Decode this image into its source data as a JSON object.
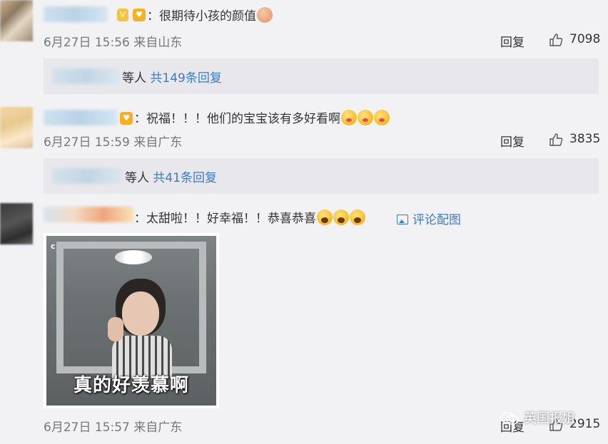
{
  "comments": [
    {
      "text": "：很期待小孩的颜值",
      "meta": "6月27日 15:56 来自山东",
      "reply_label": "回复",
      "likes": "7098",
      "replies_suffix": "等人",
      "replies_link": "共149条回复"
    },
    {
      "text": "：祝福！！！他们的宝宝该有多好看啊",
      "meta": "6月27日 15:59 来自广东",
      "reply_label": "回复",
      "likes": "3835",
      "replies_suffix": "等人",
      "replies_link": "共41条回复"
    },
    {
      "text": "：太甜啦！！好幸福！！恭喜恭喜",
      "pic_link": "评论配图",
      "image_caption": "真的好羡慕啊",
      "meta": "6月27日 15:57 来自广东",
      "reply_label": "回复",
      "likes": "2915"
    }
  ],
  "watermark": "英国报姐",
  "colors": {
    "link": "#3b7ac7",
    "meta": "#777777",
    "background": "#f2f2f5",
    "reply_box": "#e8e8ec"
  }
}
